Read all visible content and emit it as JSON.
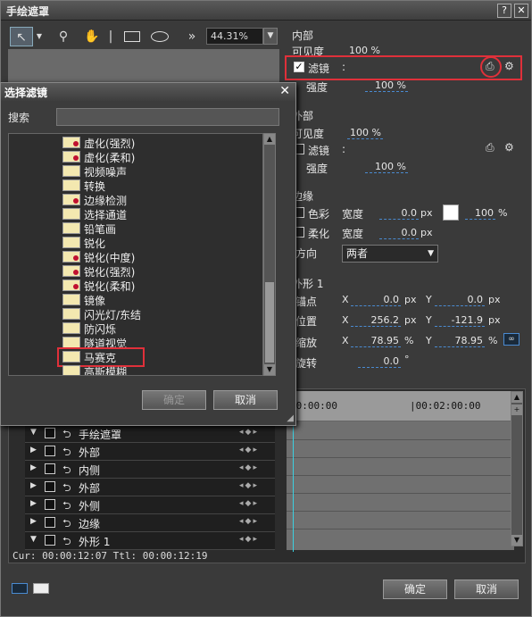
{
  "main": {
    "title": "手绘遮罩",
    "zoom": "44.31%",
    "tool_icons": [
      "pointer-icon",
      "zoom-icon",
      "hand-icon",
      "line-tool-icon",
      "rectangle-icon",
      "ellipse-icon",
      "more-icon"
    ]
  },
  "inner": {
    "header": "内部",
    "visibility_label": "可见度",
    "visibility_value": "100 %",
    "filter_label": "滤镜",
    "filter_colon": ":",
    "filter_checked": true,
    "strength_label": "强度",
    "strength_value": "100 %"
  },
  "outer": {
    "header": "外部",
    "visibility_label": "可见度",
    "visibility_value": "100 %",
    "filter_label": "滤镜",
    "filter_colon": ":",
    "strength_label": "强度",
    "strength_value": "100 %"
  },
  "edge": {
    "header": "边缘",
    "color_label": "色彩",
    "width_label": "宽度",
    "color_width_value": "0.0",
    "color_width_unit": "px",
    "opacity_value": "100",
    "opacity_unit": "%",
    "soft_label": "柔化",
    "soft_width_label": "宽度",
    "soft_width_value": "0.0",
    "soft_width_unit": "px",
    "direction_label": "方向",
    "direction_value": "两者"
  },
  "shape": {
    "header": "外形 1",
    "anchor_label": "锚点",
    "position_label": "位置",
    "scale_label": "缩放",
    "rotate_label": "旋转",
    "x": "X",
    "y": "Y",
    "anchor_x": "0.0",
    "anchor_y": "0.0",
    "pos_x": "256.2",
    "pos_y": "-121.9",
    "scale_x": "78.95",
    "scale_y": "78.95",
    "rotate_value": "0.0",
    "px": "px",
    "pct": "%",
    "deg": "°"
  },
  "timeline": {
    "ruler": [
      "00:00:00",
      "|00:02:00:00"
    ],
    "tracks": [
      "手绘遮罩",
      "外部",
      "内侧",
      "外部",
      "外侧",
      "边缘",
      "外形 1"
    ],
    "status": "Cur: 00:00:12:07  Ttl: 00:00:12:19"
  },
  "buttons": {
    "ok": "确定",
    "cancel": "取消"
  },
  "dialog": {
    "title": "选择滤镜",
    "search_label": "搜索",
    "search_value": "",
    "items": [
      {
        "label": "虚化(强烈)",
        "red": true
      },
      {
        "label": "虚化(柔和)",
        "red": true
      },
      {
        "label": "视频噪声",
        "red": false
      },
      {
        "label": "转换",
        "red": false
      },
      {
        "label": "边缘检测",
        "red": true
      },
      {
        "label": "选择通道",
        "red": false
      },
      {
        "label": "铅笔画",
        "red": false
      },
      {
        "label": "锐化",
        "red": false
      },
      {
        "label": "锐化(中度)",
        "red": true
      },
      {
        "label": "锐化(强烈)",
        "red": true
      },
      {
        "label": "锐化(柔和)",
        "red": true
      },
      {
        "label": "镜像",
        "red": false
      },
      {
        "label": "闪光灯/东结",
        "red": false
      },
      {
        "label": "防闪烁",
        "red": false
      },
      {
        "label": "隧道视觉",
        "red": false
      },
      {
        "label": "马赛克",
        "red": false
      },
      {
        "label": "高斯模糊",
        "red": false
      }
    ],
    "highlighted": "马赛克",
    "ok": "确定",
    "cancel": "取消"
  },
  "colors": {
    "highlight": "#e0303a",
    "accent": "#4a8ad0",
    "playhead": "#3ad0e0"
  }
}
